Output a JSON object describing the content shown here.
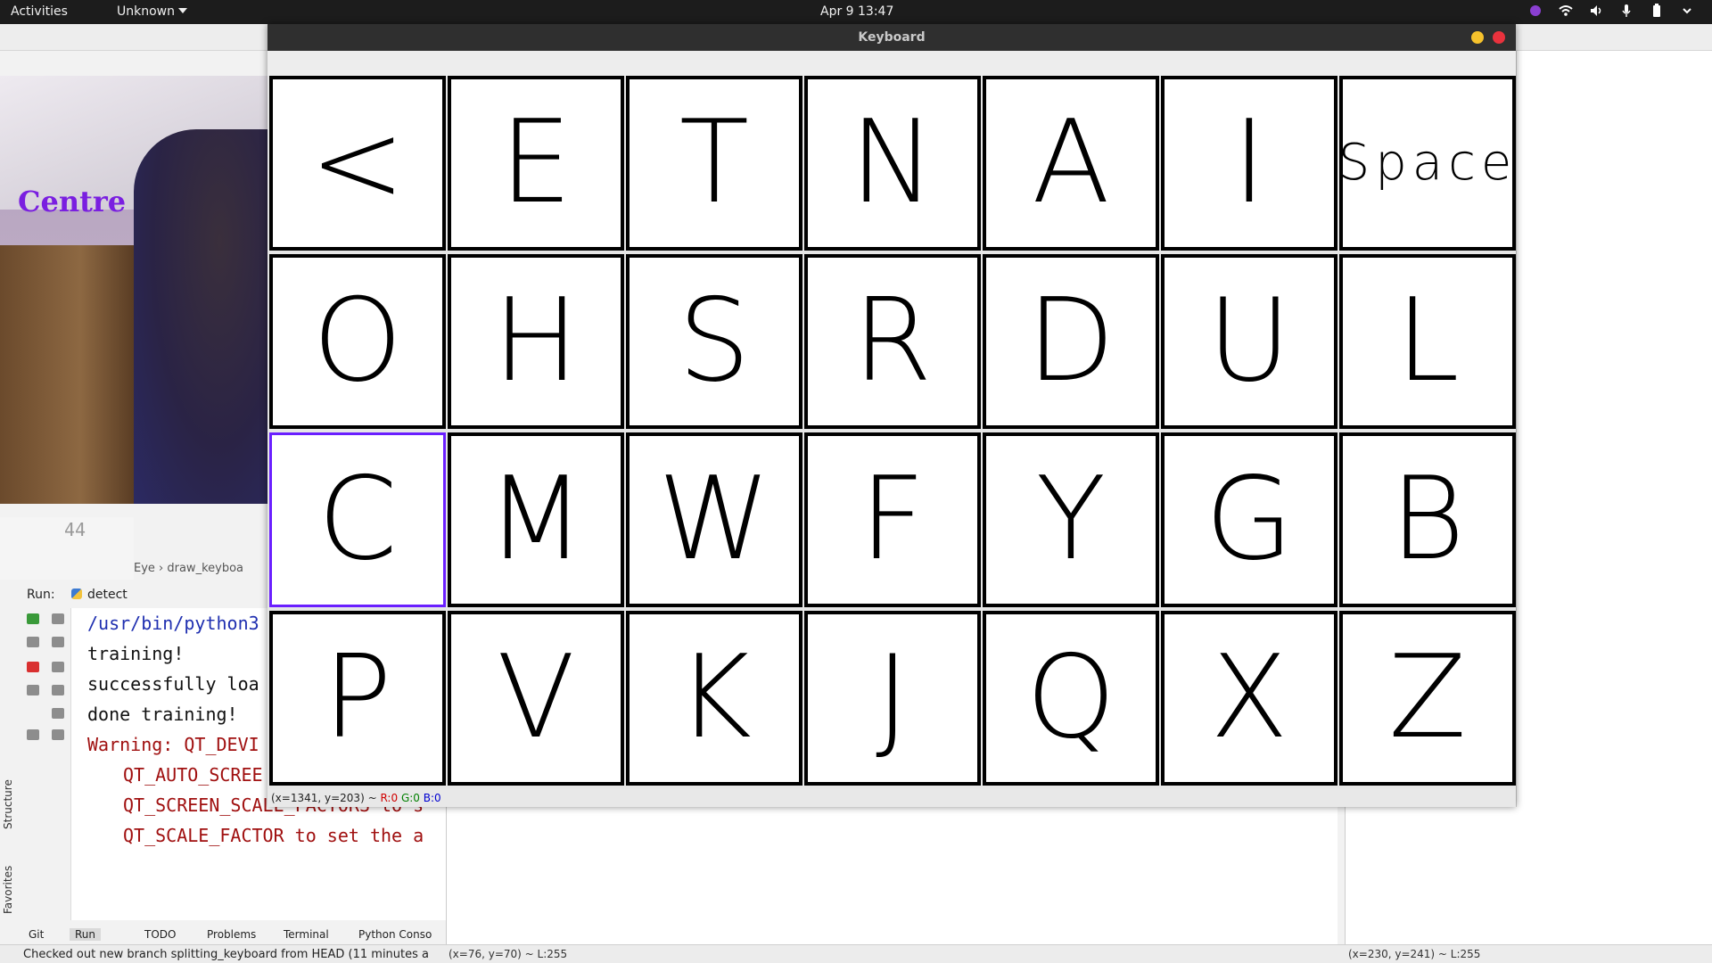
{
  "topbar": {
    "activities": "Activities",
    "app_menu": "Unknown",
    "clock": "Apr 9  13:47"
  },
  "camera": {
    "overlay_text": "Centre",
    "overlay_color": "#7a1fe0"
  },
  "ide": {
    "line_number": "44",
    "breadcrumb": "Eye  ›  draw_keyboa",
    "run_label": "Run:",
    "run_tab": "detect",
    "console_lines": [
      {
        "text": "/usr/bin/python3",
        "style": "blue"
      },
      {
        "text": "training!",
        "style": "black"
      },
      {
        "text": "successfully loa",
        "style": "black"
      },
      {
        "text": "done training!",
        "style": "black"
      },
      {
        "text": "Warning: QT_DEVI",
        "style": "red"
      },
      {
        "text": "QT_AUTO_SCREE",
        "style": "red indent"
      },
      {
        "text": "QT_SCREEN_SCALE_FACTORS to s",
        "style": "red indent"
      },
      {
        "text": "QT_SCALE_FACTOR to set the a",
        "style": "red indent"
      }
    ],
    "side_tabs": [
      "Structure",
      "Favorites"
    ],
    "bottom_tabs": [
      "Git",
      "Run",
      "TODO",
      "Problems",
      "Terminal",
      "Python Conso"
    ],
    "status_message": "Checked out new branch splitting_keyboard from HEAD (11 minutes a",
    "status_coords_mid": "(x=76, y=70) ~ L:255",
    "status_coords_right": "(x=230, y=241) ~ L:255"
  },
  "keyboard_window": {
    "title": "Keyboard",
    "selected_color": "#6a1fff",
    "keys": [
      [
        "<",
        "E",
        "T",
        "N",
        "A",
        "I",
        "Space"
      ],
      [
        "O",
        "H",
        "S",
        "R",
        "D",
        "U",
        "L"
      ],
      [
        "C",
        "M",
        "W",
        "F",
        "Y",
        "G",
        "B"
      ],
      [
        "P",
        "V",
        "K",
        "J",
        "Q",
        "X",
        "Z"
      ]
    ],
    "selected_key": "C",
    "status": {
      "coords": "(x=1341, y=203) ~",
      "r": "R:0",
      "g": "G:0",
      "b": "B:0"
    }
  }
}
